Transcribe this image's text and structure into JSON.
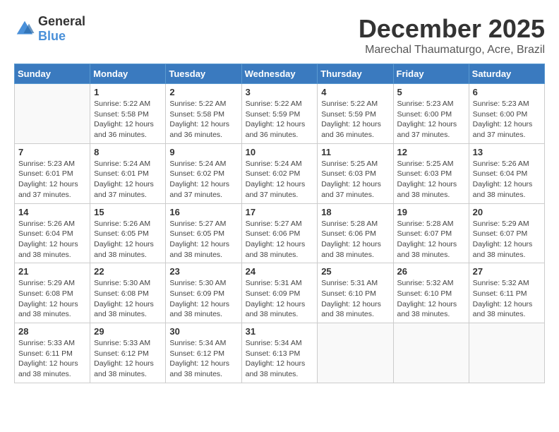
{
  "header": {
    "logo_general": "General",
    "logo_blue": "Blue",
    "month": "December 2025",
    "location": "Marechal Thaumaturgo, Acre, Brazil"
  },
  "weekdays": [
    "Sunday",
    "Monday",
    "Tuesday",
    "Wednesday",
    "Thursday",
    "Friday",
    "Saturday"
  ],
  "weeks": [
    [
      {
        "day": "",
        "sunrise": "",
        "sunset": "",
        "daylight": ""
      },
      {
        "day": "1",
        "sunrise": "Sunrise: 5:22 AM",
        "sunset": "Sunset: 5:58 PM",
        "daylight": "Daylight: 12 hours and 36 minutes."
      },
      {
        "day": "2",
        "sunrise": "Sunrise: 5:22 AM",
        "sunset": "Sunset: 5:58 PM",
        "daylight": "Daylight: 12 hours and 36 minutes."
      },
      {
        "day": "3",
        "sunrise": "Sunrise: 5:22 AM",
        "sunset": "Sunset: 5:59 PM",
        "daylight": "Daylight: 12 hours and 36 minutes."
      },
      {
        "day": "4",
        "sunrise": "Sunrise: 5:22 AM",
        "sunset": "Sunset: 5:59 PM",
        "daylight": "Daylight: 12 hours and 36 minutes."
      },
      {
        "day": "5",
        "sunrise": "Sunrise: 5:23 AM",
        "sunset": "Sunset: 6:00 PM",
        "daylight": "Daylight: 12 hours and 37 minutes."
      },
      {
        "day": "6",
        "sunrise": "Sunrise: 5:23 AM",
        "sunset": "Sunset: 6:00 PM",
        "daylight": "Daylight: 12 hours and 37 minutes."
      }
    ],
    [
      {
        "day": "7",
        "sunrise": "Sunrise: 5:23 AM",
        "sunset": "Sunset: 6:01 PM",
        "daylight": "Daylight: 12 hours and 37 minutes."
      },
      {
        "day": "8",
        "sunrise": "Sunrise: 5:24 AM",
        "sunset": "Sunset: 6:01 PM",
        "daylight": "Daylight: 12 hours and 37 minutes."
      },
      {
        "day": "9",
        "sunrise": "Sunrise: 5:24 AM",
        "sunset": "Sunset: 6:02 PM",
        "daylight": "Daylight: 12 hours and 37 minutes."
      },
      {
        "day": "10",
        "sunrise": "Sunrise: 5:24 AM",
        "sunset": "Sunset: 6:02 PM",
        "daylight": "Daylight: 12 hours and 37 minutes."
      },
      {
        "day": "11",
        "sunrise": "Sunrise: 5:25 AM",
        "sunset": "Sunset: 6:03 PM",
        "daylight": "Daylight: 12 hours and 37 minutes."
      },
      {
        "day": "12",
        "sunrise": "Sunrise: 5:25 AM",
        "sunset": "Sunset: 6:03 PM",
        "daylight": "Daylight: 12 hours and 38 minutes."
      },
      {
        "day": "13",
        "sunrise": "Sunrise: 5:26 AM",
        "sunset": "Sunset: 6:04 PM",
        "daylight": "Daylight: 12 hours and 38 minutes."
      }
    ],
    [
      {
        "day": "14",
        "sunrise": "Sunrise: 5:26 AM",
        "sunset": "Sunset: 6:04 PM",
        "daylight": "Daylight: 12 hours and 38 minutes."
      },
      {
        "day": "15",
        "sunrise": "Sunrise: 5:26 AM",
        "sunset": "Sunset: 6:05 PM",
        "daylight": "Daylight: 12 hours and 38 minutes."
      },
      {
        "day": "16",
        "sunrise": "Sunrise: 5:27 AM",
        "sunset": "Sunset: 6:05 PM",
        "daylight": "Daylight: 12 hours and 38 minutes."
      },
      {
        "day": "17",
        "sunrise": "Sunrise: 5:27 AM",
        "sunset": "Sunset: 6:06 PM",
        "daylight": "Daylight: 12 hours and 38 minutes."
      },
      {
        "day": "18",
        "sunrise": "Sunrise: 5:28 AM",
        "sunset": "Sunset: 6:06 PM",
        "daylight": "Daylight: 12 hours and 38 minutes."
      },
      {
        "day": "19",
        "sunrise": "Sunrise: 5:28 AM",
        "sunset": "Sunset: 6:07 PM",
        "daylight": "Daylight: 12 hours and 38 minutes."
      },
      {
        "day": "20",
        "sunrise": "Sunrise: 5:29 AM",
        "sunset": "Sunset: 6:07 PM",
        "daylight": "Daylight: 12 hours and 38 minutes."
      }
    ],
    [
      {
        "day": "21",
        "sunrise": "Sunrise: 5:29 AM",
        "sunset": "Sunset: 6:08 PM",
        "daylight": "Daylight: 12 hours and 38 minutes."
      },
      {
        "day": "22",
        "sunrise": "Sunrise: 5:30 AM",
        "sunset": "Sunset: 6:08 PM",
        "daylight": "Daylight: 12 hours and 38 minutes."
      },
      {
        "day": "23",
        "sunrise": "Sunrise: 5:30 AM",
        "sunset": "Sunset: 6:09 PM",
        "daylight": "Daylight: 12 hours and 38 minutes."
      },
      {
        "day": "24",
        "sunrise": "Sunrise: 5:31 AM",
        "sunset": "Sunset: 6:09 PM",
        "daylight": "Daylight: 12 hours and 38 minutes."
      },
      {
        "day": "25",
        "sunrise": "Sunrise: 5:31 AM",
        "sunset": "Sunset: 6:10 PM",
        "daylight": "Daylight: 12 hours and 38 minutes."
      },
      {
        "day": "26",
        "sunrise": "Sunrise: 5:32 AM",
        "sunset": "Sunset: 6:10 PM",
        "daylight": "Daylight: 12 hours and 38 minutes."
      },
      {
        "day": "27",
        "sunrise": "Sunrise: 5:32 AM",
        "sunset": "Sunset: 6:11 PM",
        "daylight": "Daylight: 12 hours and 38 minutes."
      }
    ],
    [
      {
        "day": "28",
        "sunrise": "Sunrise: 5:33 AM",
        "sunset": "Sunset: 6:11 PM",
        "daylight": "Daylight: 12 hours and 38 minutes."
      },
      {
        "day": "29",
        "sunrise": "Sunrise: 5:33 AM",
        "sunset": "Sunset: 6:12 PM",
        "daylight": "Daylight: 12 hours and 38 minutes."
      },
      {
        "day": "30",
        "sunrise": "Sunrise: 5:34 AM",
        "sunset": "Sunset: 6:12 PM",
        "daylight": "Daylight: 12 hours and 38 minutes."
      },
      {
        "day": "31",
        "sunrise": "Sunrise: 5:34 AM",
        "sunset": "Sunset: 6:13 PM",
        "daylight": "Daylight: 12 hours and 38 minutes."
      },
      {
        "day": "",
        "sunrise": "",
        "sunset": "",
        "daylight": ""
      },
      {
        "day": "",
        "sunrise": "",
        "sunset": "",
        "daylight": ""
      },
      {
        "day": "",
        "sunrise": "",
        "sunset": "",
        "daylight": ""
      }
    ]
  ]
}
